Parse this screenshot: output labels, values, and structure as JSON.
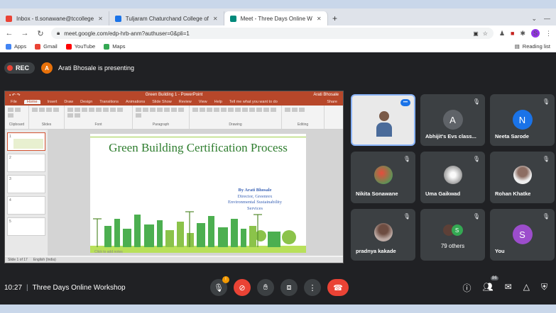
{
  "browser": {
    "tabs": [
      {
        "label": "Inbox - tl.sonawane@tccollege",
        "color": "#ea4335",
        "active": false
      },
      {
        "label": "Tuljaram Chaturchand College of",
        "color": "#1a73e8",
        "active": false
      },
      {
        "label": "Meet - Three Days Online W",
        "color": "#00897b",
        "active": true
      }
    ],
    "newtab": "+",
    "url": "meet.google.com/edp-hrb-anm?authuser=0&pli=1",
    "bookmarks": [
      "Apps",
      "Gmail",
      "YouTube",
      "Maps"
    ],
    "reading_list": "Reading list",
    "profile_initial": "S"
  },
  "meet": {
    "rec_label": "REC",
    "presenter_initial": "A",
    "presenting_text": "Arati Bhosale is presenting",
    "time": "10:27",
    "meeting_title": "Three Days Online Workshop",
    "participants": [
      {
        "name": "",
        "type": "video"
      },
      {
        "name": "Abhijit's Evs class...",
        "initial": "A",
        "color": "#5f6368"
      },
      {
        "name": "Neeta Sarode",
        "initial": "N",
        "color": "#1a73e8"
      },
      {
        "name": "Nikita Sonawane",
        "type": "photo",
        "color": "#c0392b"
      },
      {
        "name": "Uma Gaikwad",
        "type": "photo",
        "color": "#8d8d8d"
      },
      {
        "name": "Rohan Khatke",
        "type": "photo",
        "color": "#d9c7b8"
      },
      {
        "name": "pradnya kakade",
        "type": "photo",
        "color": "#7d6b5d"
      },
      {
        "name": "79 others",
        "type": "others",
        "initial": "S"
      },
      {
        "name": "You",
        "initial": "S",
        "color": "#9c4dcc"
      }
    ],
    "hand_badge": "!",
    "people_count": "86"
  },
  "ppt": {
    "window_title": "Green Building 1 - PowerPoint",
    "user": "Arati Bhosale",
    "menu": [
      "File",
      "Home",
      "Insert",
      "Draw",
      "Design",
      "Transitions",
      "Animations",
      "Slide Show",
      "Review",
      "View",
      "Help",
      "Tell me what you want to do",
      "Share"
    ],
    "ribbon_groups": [
      "Clipboard",
      "Slides",
      "Font",
      "Paragraph",
      "Drawing",
      "Editing"
    ],
    "slide": {
      "title": "Green Building Certification Process",
      "by": "By Arati Bhosale",
      "role": "Director, Greenrex",
      "org": "Environmental Sustainability",
      "services": "Services"
    },
    "notes": "Click to add notes",
    "status": "Slide 1 of 17",
    "lang": "English (India)"
  }
}
